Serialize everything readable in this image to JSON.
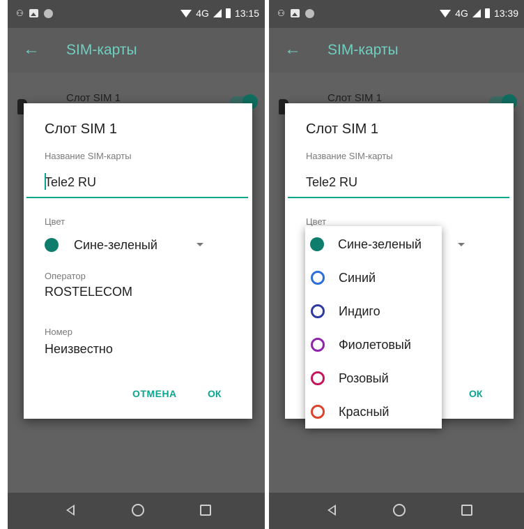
{
  "screens": [
    {
      "status_bar": {
        "time": "13:15",
        "network": "4G"
      },
      "app_bar": {
        "title": "SIM-карты"
      },
      "list": {
        "item_label": "Слот SIM 1"
      },
      "dialog": {
        "title": "Слот SIM 1",
        "name_label": "Название SIM-карты",
        "name_value": "Tele2 RU",
        "color_label": "Цвет",
        "color_value": "Сине-зеленый",
        "operator_label": "Оператор",
        "operator_value": "ROSTELECOM",
        "number_label": "Номер",
        "number_value": "Неизвестно",
        "cancel_label": "ОТМЕНА",
        "ok_label": "ОК"
      }
    },
    {
      "status_bar": {
        "time": "13:39",
        "network": "4G"
      },
      "app_bar": {
        "title": "SIM-карты"
      },
      "list": {
        "item_label": "Слот SIM 1"
      },
      "dialog": {
        "title": "Слот SIM 1",
        "name_label": "Название SIM-карты",
        "name_value": "Tele2 RU",
        "color_label": "Цвет",
        "ok_label": "ОК"
      },
      "color_dropdown": {
        "options": [
          {
            "label": "Сине-зеленый",
            "color": "#0e7d6c",
            "filled": true
          },
          {
            "label": "Синий",
            "color": "#2b6fd6",
            "filled": false
          },
          {
            "label": "Индиго",
            "color": "#2f3aa0",
            "filled": false
          },
          {
            "label": "Фиолетовый",
            "color": "#8e24aa",
            "filled": false
          },
          {
            "label": "Розовый",
            "color": "#c2185b",
            "filled": false
          },
          {
            "label": "Красный",
            "color": "#d8432a",
            "filled": false
          }
        ]
      }
    }
  ],
  "icons": {
    "status_left": [
      "people-icon",
      "image-icon",
      "circle-icon"
    ],
    "status_right": [
      "wifi-icon",
      "signal-icon",
      "battery-icon"
    ],
    "nav": [
      "back-nav-icon",
      "home-nav-icon",
      "recents-nav-icon"
    ],
    "appbar": "back-arrow-icon"
  },
  "colors": {
    "accent": "#0aa58f",
    "appbar_title": "#6fcfc0",
    "selected_color": "#0e7d6c"
  }
}
